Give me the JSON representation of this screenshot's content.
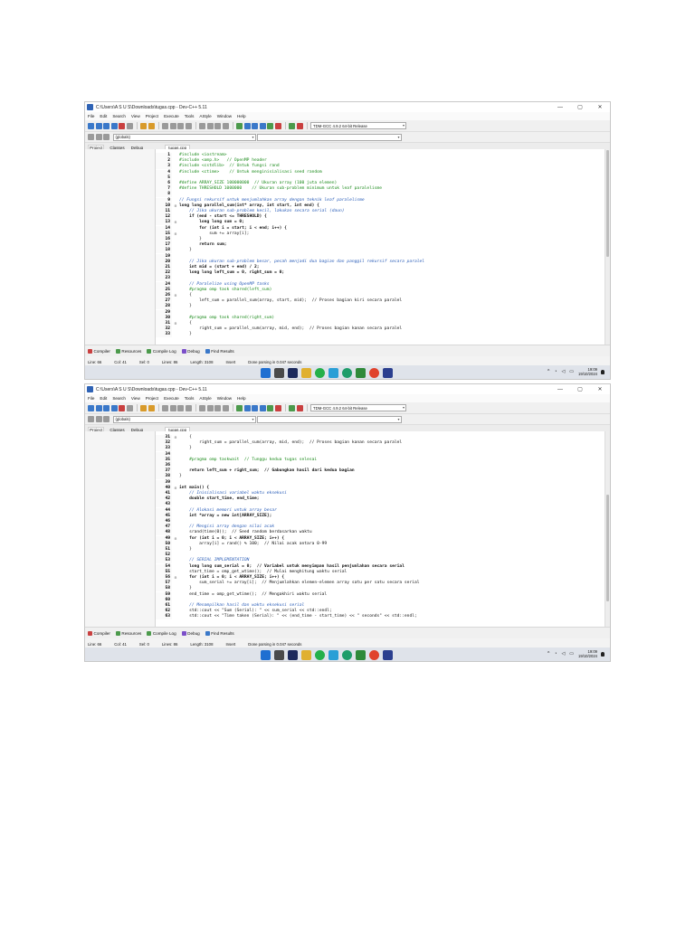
{
  "window": {
    "title": "C:\\Users\\A S U S\\Downloads\\tugas.cpp - Dev-C++ 5.11",
    "minimize": "—",
    "maximize": "▢",
    "close": "✕"
  },
  "menu": [
    "File",
    "Edit",
    "Search",
    "View",
    "Project",
    "Execute",
    "Tools",
    "AStyle",
    "Window",
    "Help"
  ],
  "compiler_select": "TDM-GCC 4.9.2 64-bit Release",
  "scope_select": "(globals)",
  "left_tabs": [
    "Project",
    "Classes",
    "Debug"
  ],
  "file_tab": "tugas.cpp",
  "bottom_tabs": [
    "Compiler",
    "Resources",
    "Compile Log",
    "Debug",
    "Find Results"
  ],
  "status": {
    "line": "Line:   66",
    "col": "Col:   41",
    "sel": "Sel:   0",
    "lines": "Lines:   86",
    "length": "Length:   3108",
    "mode": "Insert",
    "message": "Done parsing in 0.047 seconds"
  },
  "clock": {
    "time": "19:09",
    "date": "19/10/2024"
  },
  "icons": {
    "app": "devcpp-icon",
    "taskbar": [
      "windows-start-icon",
      "search-icon",
      "browser-icon",
      "file-explorer-icon",
      "whatsapp-icon",
      "telegram-icon",
      "whatsapp-business-icon",
      "dev-cpp-icon",
      "chrome-icon",
      "app-icon"
    ],
    "tray": [
      "chevron-up-icon",
      "wifi-icon",
      "volume-icon",
      "battery-icon",
      "notification-icon"
    ]
  },
  "colors": {
    "comment": "#2a5db8",
    "preprocessor": "#1a8a1a",
    "taskbar": "#dfe3ea"
  },
  "screens": [
    {
      "lines": [
        {
          "n": "1",
          "fold": "",
          "text": "#include <iostream>",
          "cls": "pp"
        },
        {
          "n": "2",
          "fold": "",
          "text": "#include <omp.h>   // OpenMP header",
          "cls": "pp"
        },
        {
          "n": "3",
          "fold": "",
          "text": "#include <cstdlib>  // Untuk fungsi rand",
          "cls": "pp"
        },
        {
          "n": "4",
          "fold": "",
          "text": "#include <ctime>    // Untuk menginisialisasi seed random",
          "cls": "pp"
        },
        {
          "n": "5",
          "fold": "",
          "text": "",
          "cls": ""
        },
        {
          "n": "6",
          "fold": "",
          "text": "#define ARRAY_SIZE 100000000  // Ukuran array (100 juta elemen)",
          "cls": "pp"
        },
        {
          "n": "7",
          "fold": "",
          "text": "#define THRESHOLD 1000000    // Ukuran sub-problem minimum untuk leaf paralelisme",
          "cls": "pp"
        },
        {
          "n": "8",
          "fold": "",
          "text": "",
          "cls": ""
        },
        {
          "n": "9",
          "fold": "",
          "text": "// Fungsi rekursif untuk menjumlahkan array dengan teknik leaf paralelisme",
          "cls": "cm"
        },
        {
          "n": "10",
          "fold": "⊟",
          "text": "long long parallel_sum(int* array, int start, int end) {",
          "cls": "hl"
        },
        {
          "n": "11",
          "fold": "",
          "text": "    // Jika ukuran sub-problem kecil, lakukan secara serial (daun)",
          "cls": "cm"
        },
        {
          "n": "12",
          "fold": "",
          "text": "    if (end - start <= THRESHOLD) {",
          "cls": "kw"
        },
        {
          "n": "13",
          "fold": "⊟",
          "text": "        long long sum = 0;",
          "cls": "kw"
        },
        {
          "n": "14",
          "fold": "",
          "text": "        for (int i = start; i < end; i++) {",
          "cls": "kw"
        },
        {
          "n": "15",
          "fold": "⊟",
          "text": "            sum += array[i];",
          "cls": ""
        },
        {
          "n": "16",
          "fold": "",
          "text": "        }",
          "cls": ""
        },
        {
          "n": "17",
          "fold": "",
          "text": "        return sum;",
          "cls": "kw"
        },
        {
          "n": "18",
          "fold": "",
          "text": "    }",
          "cls": ""
        },
        {
          "n": "19",
          "fold": "",
          "text": "",
          "cls": ""
        },
        {
          "n": "20",
          "fold": "",
          "text": "    // Jika ukuran sub-problem besar, pecah menjadi dua bagian dan panggil rekursif secara paralel",
          "cls": "cm"
        },
        {
          "n": "21",
          "fold": "",
          "text": "    int mid = (start + end) / 2;",
          "cls": "kw"
        },
        {
          "n": "22",
          "fold": "",
          "text": "    long long left_sum = 0, right_sum = 0;",
          "cls": "kw"
        },
        {
          "n": "23",
          "fold": "",
          "text": "",
          "cls": ""
        },
        {
          "n": "24",
          "fold": "",
          "text": "    // Paralelize using OpenMP tasks",
          "cls": "cm"
        },
        {
          "n": "25",
          "fold": "",
          "text": "    #pragma omp task shared(left_sum)",
          "cls": "pp"
        },
        {
          "n": "26",
          "fold": "⊟",
          "text": "    {",
          "cls": ""
        },
        {
          "n": "27",
          "fold": "",
          "text": "        left_sum = parallel_sum(array, start, mid);  // Proses bagian kiri secara paralel",
          "cls": ""
        },
        {
          "n": "28",
          "fold": "",
          "text": "    }",
          "cls": ""
        },
        {
          "n": "29",
          "fold": "",
          "text": "",
          "cls": ""
        },
        {
          "n": "30",
          "fold": "",
          "text": "    #pragma omp task shared(right_sum)",
          "cls": "pp"
        },
        {
          "n": "31",
          "fold": "⊟",
          "text": "    {",
          "cls": ""
        },
        {
          "n": "32",
          "fold": "",
          "text": "        right_sum = parallel_sum(array, mid, end);  // Proses bagian kanan secara paralel",
          "cls": ""
        },
        {
          "n": "33",
          "fold": "",
          "text": "    }",
          "cls": ""
        }
      ]
    },
    {
      "lines": [
        {
          "n": "31",
          "fold": "⊟",
          "text": "    {",
          "cls": ""
        },
        {
          "n": "32",
          "fold": "",
          "text": "        right_sum = parallel_sum(array, mid, end);  // Proses bagian kanan secara paralel",
          "cls": ""
        },
        {
          "n": "33",
          "fold": "",
          "text": "    }",
          "cls": ""
        },
        {
          "n": "34",
          "fold": "",
          "text": "",
          "cls": ""
        },
        {
          "n": "35",
          "fold": "",
          "text": "    #pragma omp taskwait  // Tunggu kedua tugas selesai",
          "cls": "pp"
        },
        {
          "n": "36",
          "fold": "",
          "text": "",
          "cls": ""
        },
        {
          "n": "37",
          "fold": "",
          "text": "    return left_sum + right_sum;  // Gabungkan hasil dari kedua bagian",
          "cls": "kw"
        },
        {
          "n": "38",
          "fold": "",
          "text": "}",
          "cls": ""
        },
        {
          "n": "39",
          "fold": "",
          "text": "",
          "cls": ""
        },
        {
          "n": "40",
          "fold": "⊟",
          "text": "int main() {",
          "cls": "hl"
        },
        {
          "n": "41",
          "fold": "",
          "text": "    // Inisialisasi variabel waktu eksekusi",
          "cls": "cm"
        },
        {
          "n": "42",
          "fold": "",
          "text": "    double start_time, end_time;",
          "cls": "kw"
        },
        {
          "n": "43",
          "fold": "",
          "text": "",
          "cls": ""
        },
        {
          "n": "44",
          "fold": "",
          "text": "    // Alokasi memori untuk array besar",
          "cls": "cm"
        },
        {
          "n": "45",
          "fold": "",
          "text": "    int *array = new int[ARRAY_SIZE];",
          "cls": "kw"
        },
        {
          "n": "46",
          "fold": "",
          "text": "",
          "cls": ""
        },
        {
          "n": "47",
          "fold": "",
          "text": "    // Mengisi array dengan nilai acak",
          "cls": "cm"
        },
        {
          "n": "48",
          "fold": "",
          "text": "    srand(time(0));  // Seed random berdasarkan waktu",
          "cls": ""
        },
        {
          "n": "49",
          "fold": "⊟",
          "text": "    for (int i = 0; i < ARRAY_SIZE; i++) {",
          "cls": "kw"
        },
        {
          "n": "50",
          "fold": "",
          "text": "        array[i] = rand() % 100;  // Nilai acak antara 0-99",
          "cls": ""
        },
        {
          "n": "51",
          "fold": "",
          "text": "    }",
          "cls": ""
        },
        {
          "n": "52",
          "fold": "",
          "text": "",
          "cls": ""
        },
        {
          "n": "53",
          "fold": "",
          "text": "    // SERIAL IMPLEMENTATION",
          "cls": "cm"
        },
        {
          "n": "54",
          "fold": "",
          "text": "    long long sum_serial = 0;  // Variabel untuk menyimpan hasil penjumlahan secara serial",
          "cls": "kw"
        },
        {
          "n": "55",
          "fold": "",
          "text": "    start_time = omp_get_wtime();  // Mulai menghitung waktu serial",
          "cls": ""
        },
        {
          "n": "56",
          "fold": "⊟",
          "text": "    for (int i = 0; i < ARRAY_SIZE; i++) {",
          "cls": "kw"
        },
        {
          "n": "57",
          "fold": "",
          "text": "        sum_serial += array[i];  // Menjumlahkan elemen-elemen array satu per satu secara serial",
          "cls": ""
        },
        {
          "n": "58",
          "fold": "",
          "text": "    }",
          "cls": ""
        },
        {
          "n": "59",
          "fold": "",
          "text": "    end_time = omp_get_wtime();  // Mengakhiri waktu serial",
          "cls": ""
        },
        {
          "n": "60",
          "fold": "",
          "text": "",
          "cls": ""
        },
        {
          "n": "61",
          "fold": "",
          "text": "    // Menampilkan hasil dan waktu eksekusi serial",
          "cls": "cm"
        },
        {
          "n": "62",
          "fold": "",
          "text": "    std::cout << \"Sum (Serial): \" << sum_serial << std::endl;",
          "cls": ""
        },
        {
          "n": "63",
          "fold": "",
          "text": "    std::cout << \"Time taken (Serial): \" << (end_time - start_time) << \" seconds\" << std::endl;",
          "cls": ""
        }
      ]
    }
  ]
}
